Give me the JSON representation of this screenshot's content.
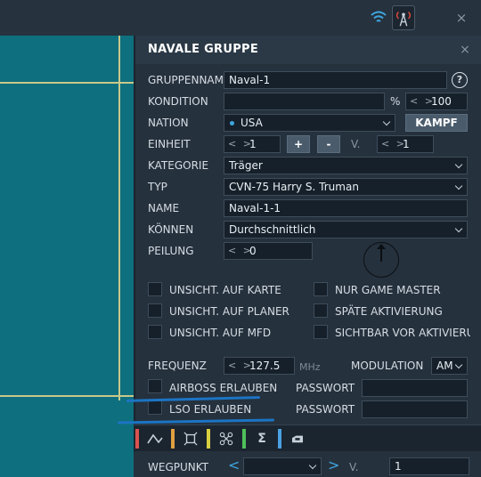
{
  "colors": {
    "map": "#0e6f7f",
    "panel": "#25313d",
    "accent_line": "#c9c98a",
    "annotation": "#1c74c4"
  },
  "topbar": {
    "close": "×"
  },
  "panel": {
    "title": "NAVALE GRUPPE",
    "close": "×",
    "gruppenname": {
      "label": "GRUPPENNAME",
      "value": "Naval-1"
    },
    "help": "?",
    "kondition": {
      "label": "KONDITION",
      "value": "",
      "percent": "%",
      "spin": "100"
    },
    "nation": {
      "label": "NATION",
      "value": "USA",
      "button": "KAMPF"
    },
    "einheit": {
      "label": "EINHEIT",
      "value": "1",
      "plus": "+",
      "minus": "-",
      "v_label": "V.",
      "v_value": "1"
    },
    "kategorie": {
      "label": "KATEGORIE",
      "value": "Träger"
    },
    "typ": {
      "label": "TYP",
      "value": "CVN-75 Harry S. Truman"
    },
    "name": {
      "label": "NAME",
      "value": "Naval-1-1"
    },
    "koennen": {
      "label": "KÖNNEN",
      "value": "Durchschnittlich"
    },
    "peilung": {
      "label": "PEILUNG",
      "value": "0"
    },
    "checkboxes": {
      "unsicht_karte": "UNSICHT. AUF KARTE",
      "nur_gm": "NUR GAME MASTER",
      "unsicht_planer": "UNSICHT. AUF PLANER",
      "spaete": "SPÄTE AKTIVIERUNG",
      "unsicht_mfd": "UNSICHT. AUF MFD",
      "sichtbar_vor": "SICHTBAR VOR AKTIVIERU"
    },
    "frequenz": {
      "label": "FREQUENZ",
      "value": "127.5",
      "unit": "MHz"
    },
    "modulation": {
      "label": "MODULATION",
      "value": "AM"
    },
    "airboss": {
      "label": "AIRBOSS ERLAUBEN",
      "pw_label": "PASSWORT"
    },
    "lso": {
      "label": "LSO ERLAUBEN",
      "pw_label": "PASSWORT"
    },
    "tabs": [
      {
        "icon": "route-icon",
        "color": "#d9534f"
      },
      {
        "icon": "target-icon",
        "color": "#e0a040"
      },
      {
        "icon": "drone-icon",
        "color": "#d8d040"
      },
      {
        "icon": "sigma-icon",
        "color": "#4fc05a"
      },
      {
        "icon": "payload-icon",
        "color": "#4aa0e0"
      }
    ],
    "tab_glyphs": {
      "sigma": "Σ"
    },
    "wegpunkt": {
      "label": "WEGPUNKT",
      "v_label": "V.",
      "v_value": "1"
    }
  }
}
